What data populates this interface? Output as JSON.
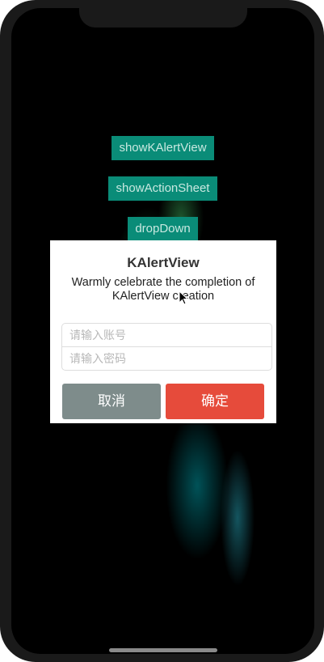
{
  "buttons": {
    "show_kalert": "showKAlertView",
    "show_action_sheet": "showActionSheet",
    "drop_down": "dropDown"
  },
  "alert": {
    "title": "KAlertView",
    "message": "Warmly celebrate the completion of KAlertView creation",
    "account_placeholder": "请输入账号",
    "password_placeholder": "请输入密码",
    "cancel_label": "取消",
    "confirm_label": "确定"
  },
  "colors": {
    "accent_teal": "#0a8c78",
    "cancel_gray": "#7e8c8b",
    "confirm_red": "#e64b3b"
  },
  "icons": [
    "mouse-pointer-icon"
  ]
}
